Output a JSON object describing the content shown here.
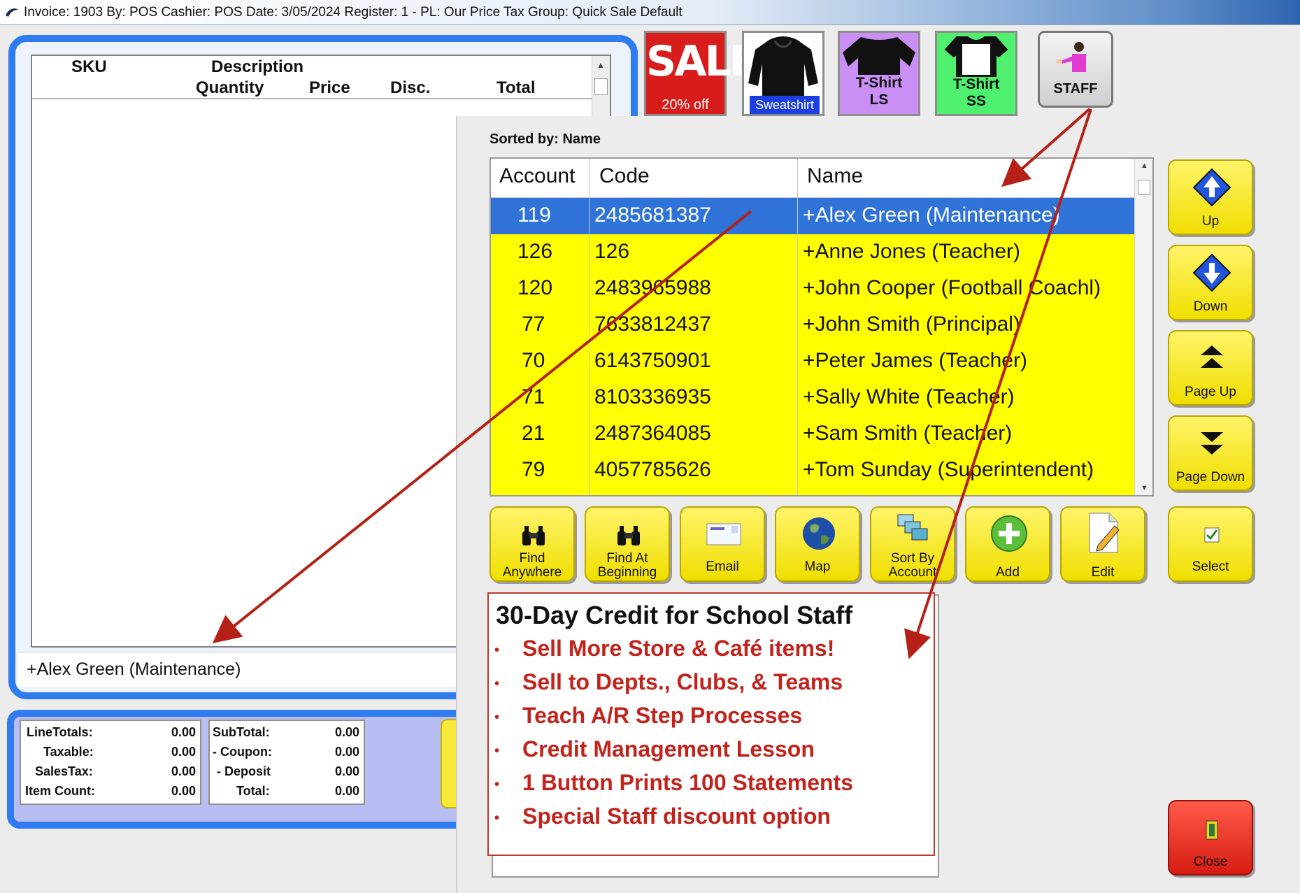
{
  "titlebar": {
    "text": "Invoice: 1903  By: POS  Cashier: POS  Date:  3/05/2024  Register: 1 - PL: Our Price  Tax Group: Quick Sale Default"
  },
  "invoice": {
    "headers": {
      "sku": "SKU",
      "description": "Description",
      "quantity": "Quantity",
      "price": "Price",
      "disc": "Disc.",
      "total": "Total"
    },
    "customer": "+Alex Green (Maintenance)"
  },
  "totals": {
    "left": [
      {
        "label": "LineTotals:",
        "value": "0.00"
      },
      {
        "label": "Taxable:",
        "value": "0.00"
      },
      {
        "label": "SalesTax:",
        "value": "0.00"
      },
      {
        "label": "Item Count:",
        "value": "0.00"
      }
    ],
    "right": [
      {
        "label": "SubTotal:",
        "value": "0.00"
      },
      {
        "label": "- Coupon:",
        "value": "0.00"
      },
      {
        "label": "- Deposit",
        "value": "0.00"
      },
      {
        "label": "Total:",
        "value": "0.00"
      }
    ]
  },
  "quick_buttons": {
    "sale": {
      "big": "SALE",
      "small": "20% off"
    },
    "sweatshirt": "Sweatshirt",
    "tshirt_ls": [
      "T-Shirt",
      "LS"
    ],
    "tshirt_ss": [
      "T-Shirt",
      "SS"
    ],
    "staff": "STAFF"
  },
  "staff_list": {
    "sorted_by": "Sorted by: Name",
    "columns": [
      "Account",
      "Code",
      "Name"
    ],
    "rows": [
      {
        "account": "119",
        "code": "2485681387",
        "name": "+Alex Green (Maintenance)"
      },
      {
        "account": "126",
        "code": "126",
        "name": "+Anne Jones (Teacher)"
      },
      {
        "account": "120",
        "code": "2483965988",
        "name": "+John Cooper (Football Coachl)"
      },
      {
        "account": "77",
        "code": "7633812437",
        "name": "+John Smith (Principal)"
      },
      {
        "account": "70",
        "code": "6143750901",
        "name": "+Peter James (Teacher)"
      },
      {
        "account": "71",
        "code": "8103336935",
        "name": "+Sally White (Teacher)"
      },
      {
        "account": "21",
        "code": "2487364085",
        "name": "+Sam Smith (Teacher)"
      },
      {
        "account": "79",
        "code": "4057785626",
        "name": "+Tom Sunday (Superintendent)"
      }
    ]
  },
  "nav_buttons": {
    "up": "Up",
    "down": "Down",
    "page_up": "Page Up",
    "page_down": "Page Down",
    "select": "Select",
    "close": "Close"
  },
  "action_buttons": {
    "find_anywhere": [
      "Find",
      "Anywhere"
    ],
    "find_beginning": [
      "Find At",
      "Beginning"
    ],
    "email": "Email",
    "map": "Map",
    "sort_account": [
      "Sort By",
      "Account"
    ],
    "add": "Add",
    "edit": "Edit"
  },
  "info": {
    "title": "30-Day Credit for School Staff",
    "bullets": [
      "Sell More Store & Café items!",
      "Sell to Depts., Clubs, & Teams",
      "Teach A/R Step Processes",
      "Credit Management Lesson",
      "1 Button Prints 100 Statements",
      "Special Staff discount option"
    ]
  },
  "colors": {
    "selected_row": "#2f73d8",
    "row_yellow": "#ffff00",
    "frame_blue": "#2f7cf0",
    "annotation_red": "#c1241c"
  }
}
